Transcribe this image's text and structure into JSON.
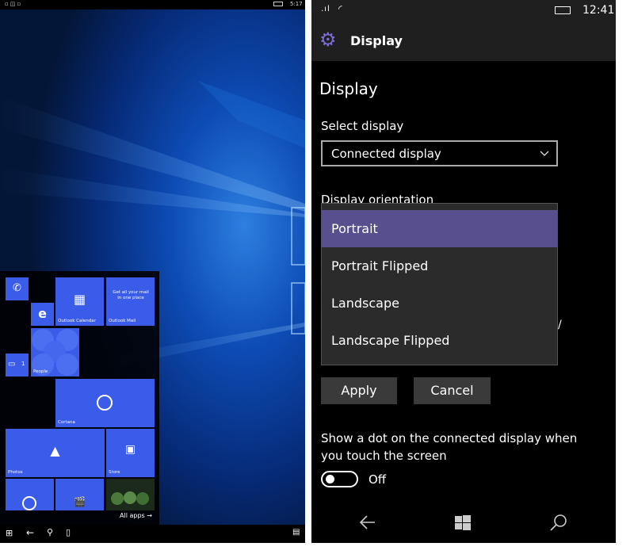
{
  "left_phone": {
    "status_time": "5:17",
    "tiles": {
      "outlook_calendar": "Outlook Calendar",
      "outlook_mail": "Outlook Mail",
      "mail_promo": "Get all your mail in one place",
      "people": "People",
      "cortana": "Cortana",
      "photos": "Photos",
      "store": "Store",
      "badge_count": "1"
    },
    "all_apps": "All apps →"
  },
  "right_phone": {
    "status_time": "12:41",
    "header_title": "Display",
    "page_title": "Display",
    "select_display_label": "Select display",
    "select_display_value": "Connected display",
    "orientation_label": "Display orientation",
    "orientation_options": [
      "Portrait",
      "Portrait Flipped",
      "Landscape",
      "Landscape Flipped"
    ],
    "selected_option": "Portrait",
    "apply_label": "Apply",
    "cancel_label": "Cancel",
    "dot_setting_label": "Show a dot on the connected display when you touch the screen",
    "toggle_state": "Off"
  },
  "colors": {
    "accent": "#3b5ce8",
    "selected_option_bg": "#574f8e",
    "dropdown_bg": "#2b2b2b",
    "header_bg": "#1f1f1f"
  }
}
